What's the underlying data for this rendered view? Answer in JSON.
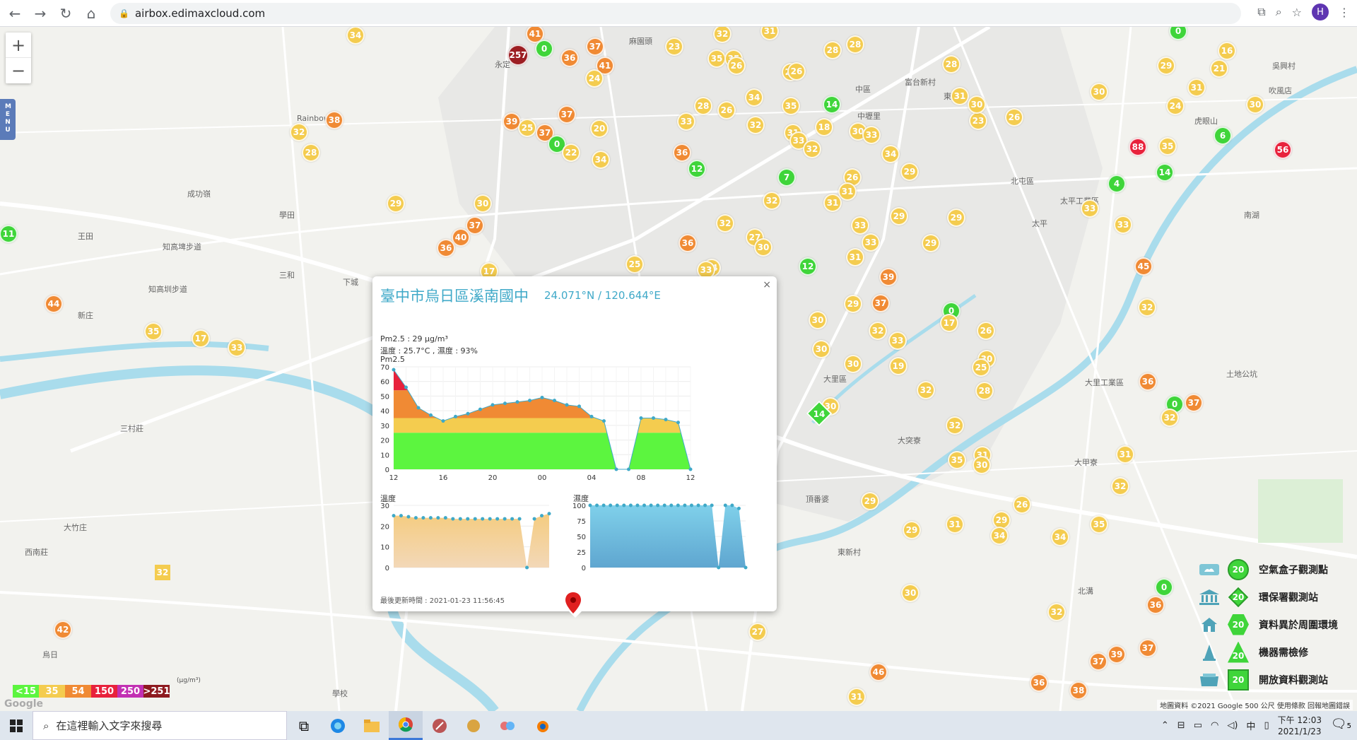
{
  "browser": {
    "url": "airbox.edimaxcloud.com",
    "profile_initial": "H",
    "icons": [
      "back-icon",
      "forward-icon",
      "reload-icon",
      "home-icon",
      "translate-icon",
      "zoom-icon",
      "star-icon",
      "kebab-icon"
    ]
  },
  "map": {
    "zoom_in": "+",
    "zoom_out": "−",
    "menu_label": "MENU",
    "markers": [
      {
        "v": "34",
        "c": "y"
      },
      {
        "v": "41",
        "c": "o"
      },
      {
        "v": "257",
        "c": "d"
      },
      {
        "v": "0",
        "c": "g"
      },
      {
        "v": "36",
        "c": "o"
      },
      {
        "v": "37",
        "c": "o"
      },
      {
        "v": "41",
        "c": "o"
      },
      {
        "v": "24",
        "c": "y"
      },
      {
        "v": "23",
        "c": "y"
      },
      {
        "v": "35",
        "c": "y"
      },
      {
        "v": "32",
        "c": "y"
      },
      {
        "v": "35",
        "c": "y"
      },
      {
        "v": "26",
        "c": "y"
      },
      {
        "v": "31",
        "c": "y"
      },
      {
        "v": "28",
        "c": "y"
      },
      {
        "v": "28",
        "c": "y"
      },
      {
        "v": "26",
        "c": "y"
      },
      {
        "v": "16",
        "c": "y"
      },
      {
        "v": "0",
        "c": "g"
      },
      {
        "v": "29",
        "c": "y"
      },
      {
        "v": "21",
        "c": "y"
      },
      {
        "v": "30",
        "c": "y"
      },
      {
        "v": "31",
        "c": "y"
      },
      {
        "v": "30",
        "c": "y"
      },
      {
        "v": "38",
        "c": "o"
      },
      {
        "v": "32",
        "c": "y"
      },
      {
        "v": "28",
        "c": "y"
      },
      {
        "v": "39",
        "c": "o"
      },
      {
        "v": "25",
        "c": "y"
      },
      {
        "v": "37",
        "c": "o"
      },
      {
        "v": "37",
        "c": "o"
      },
      {
        "v": "0",
        "c": "g"
      },
      {
        "v": "22",
        "c": "y"
      },
      {
        "v": "20",
        "c": "y"
      },
      {
        "v": "34",
        "c": "y"
      },
      {
        "v": "36",
        "c": "o"
      },
      {
        "v": "33",
        "c": "y"
      },
      {
        "v": "28",
        "c": "y"
      },
      {
        "v": "12",
        "c": "g"
      },
      {
        "v": "26",
        "c": "y"
      },
      {
        "v": "32",
        "c": "y"
      },
      {
        "v": "26",
        "c": "y"
      },
      {
        "v": "34",
        "c": "y"
      },
      {
        "v": "35",
        "c": "y"
      },
      {
        "v": "14",
        "c": "g"
      },
      {
        "v": "18",
        "c": "y"
      },
      {
        "v": "31",
        "c": "y"
      },
      {
        "v": "33",
        "c": "y"
      },
      {
        "v": "32",
        "c": "y"
      },
      {
        "v": "30",
        "c": "y"
      },
      {
        "v": "33",
        "c": "y"
      },
      {
        "v": "34",
        "c": "y"
      },
      {
        "v": "23",
        "c": "y"
      },
      {
        "v": "26",
        "c": "y"
      },
      {
        "v": "31",
        "c": "y"
      },
      {
        "v": "30",
        "c": "y"
      },
      {
        "v": "28",
        "c": "y"
      },
      {
        "v": "7",
        "c": "g"
      },
      {
        "v": "26",
        "c": "y"
      },
      {
        "v": "31",
        "c": "y"
      },
      {
        "v": "31",
        "c": "y"
      },
      {
        "v": "29",
        "c": "y"
      },
      {
        "v": "29",
        "c": "y"
      },
      {
        "v": "88",
        "c": "r"
      },
      {
        "v": "35",
        "c": "y"
      },
      {
        "v": "56",
        "c": "r"
      },
      {
        "v": "6",
        "c": "g"
      },
      {
        "v": "24",
        "c": "y"
      },
      {
        "v": "4",
        "c": "g"
      },
      {
        "v": "14",
        "c": "g"
      },
      {
        "v": "33",
        "c": "y"
      },
      {
        "v": "33",
        "c": "y"
      },
      {
        "v": "11",
        "c": "g"
      },
      {
        "v": "29",
        "c": "y"
      },
      {
        "v": "30",
        "c": "y"
      },
      {
        "v": "37",
        "c": "o"
      },
      {
        "v": "40",
        "c": "o"
      },
      {
        "v": "36",
        "c": "o"
      },
      {
        "v": "17",
        "c": "y"
      },
      {
        "v": "25",
        "c": "y"
      },
      {
        "v": "36",
        "c": "o"
      },
      {
        "v": "34",
        "c": "y"
      },
      {
        "v": "33",
        "c": "y"
      },
      {
        "v": "32",
        "c": "y"
      },
      {
        "v": "27",
        "c": "y"
      },
      {
        "v": "30",
        "c": "y"
      },
      {
        "v": "32",
        "c": "y"
      },
      {
        "v": "33",
        "c": "y"
      },
      {
        "v": "31",
        "c": "y"
      },
      {
        "v": "33",
        "c": "y"
      },
      {
        "v": "29",
        "c": "y"
      },
      {
        "v": "29",
        "c": "y"
      },
      {
        "v": "12",
        "c": "g"
      },
      {
        "v": "45",
        "c": "o"
      },
      {
        "v": "32",
        "c": "y"
      },
      {
        "v": "32",
        "c": "y"
      },
      {
        "v": "39",
        "c": "o"
      },
      {
        "v": "37",
        "c": "o"
      },
      {
        "v": "29",
        "c": "y"
      },
      {
        "v": "0",
        "c": "g"
      },
      {
        "v": "17",
        "c": "y"
      },
      {
        "v": "26",
        "c": "y"
      },
      {
        "v": "30",
        "c": "y"
      },
      {
        "v": "30",
        "c": "y"
      },
      {
        "v": "30",
        "c": "y"
      },
      {
        "v": "33",
        "c": "y"
      },
      {
        "v": "30",
        "c": "y"
      },
      {
        "v": "19",
        "c": "y"
      },
      {
        "v": "44",
        "c": "o"
      },
      {
        "v": "35",
        "c": "y"
      },
      {
        "v": "17",
        "c": "y"
      },
      {
        "v": "33",
        "c": "y"
      },
      {
        "v": "32",
        "c": "y"
      },
      {
        "v": "25",
        "c": "y"
      },
      {
        "v": "28",
        "c": "y"
      },
      {
        "v": "36",
        "c": "o"
      },
      {
        "v": "32",
        "c": "y"
      },
      {
        "v": "31",
        "c": "y"
      },
      {
        "v": "37",
        "c": "o"
      },
      {
        "v": "0",
        "c": "g"
      },
      {
        "v": "32",
        "c": "y"
      },
      {
        "v": "31",
        "c": "y"
      },
      {
        "v": "30",
        "c": "y"
      },
      {
        "v": "35",
        "c": "y"
      },
      {
        "v": "30",
        "c": "y"
      },
      {
        "v": "26",
        "c": "y"
      },
      {
        "v": "29",
        "c": "y"
      },
      {
        "v": "31",
        "c": "y"
      },
      {
        "v": "34",
        "c": "y"
      },
      {
        "v": "29",
        "c": "y"
      },
      {
        "v": "34",
        "c": "y"
      },
      {
        "v": "35",
        "c": "y"
      },
      {
        "v": "32",
        "c": "y"
      },
      {
        "v": "30",
        "c": "y"
      },
      {
        "v": "0",
        "c": "g"
      },
      {
        "v": "36",
        "c": "o"
      },
      {
        "v": "39",
        "c": "o"
      },
      {
        "v": "32",
        "c": "y"
      },
      {
        "v": "37",
        "c": "o"
      },
      {
        "v": "37",
        "c": "o"
      },
      {
        "v": "42",
        "c": "o"
      },
      {
        "v": "27",
        "c": "y"
      },
      {
        "v": "46",
        "c": "o"
      },
      {
        "v": "31",
        "c": "y"
      },
      {
        "v": "36",
        "c": "o"
      },
      {
        "v": "38",
        "c": "o"
      },
      {
        "v": "29",
        "c": "y"
      }
    ],
    "square_markers": [
      {
        "v": "32"
      }
    ],
    "diamond_markers": [
      {
        "v": "14"
      }
    ],
    "place_labels": [
      "麻園頭",
      "永定",
      "中壢里",
      "富台新村",
      "東區",
      "吹風店",
      "吳興村",
      "虎眼山",
      "太平",
      "成功嶺",
      "學田",
      "知高埤步道",
      "知高圳步道",
      "三和",
      "下城",
      "王田",
      "新庄",
      "三村莊",
      "大竹庄",
      "西南莊",
      "烏日",
      "溪南",
      "大里區",
      "大里工業區",
      "土地公坑",
      "大甲寮",
      "頂番婆",
      "大突寮",
      "學校",
      "北溝",
      "東新村",
      "太平工業區",
      "南湖",
      "Rainbow",
      "北屯區",
      "中區"
    ],
    "google_label": "Google",
    "attribution": "地圖資料 ©2021 Google   500 公尺   使用條款   回報地圖錯誤"
  },
  "popup": {
    "title": "臺中市烏日區溪南國中",
    "coords": "24.071°N / 120.644°E",
    "pm_line": "Pm2.5 : 29 μg/m³",
    "weather_line": "溫度 : 25.7°C , 濕度 : 93%",
    "pm_chart_label": "Pm2.5",
    "temp_chart_label": "溫度",
    "humidity_chart_label": "濕度",
    "updated": "最後更新時間 : 2021-01-23 11:56:45",
    "close": "×"
  },
  "chart_data": [
    {
      "type": "area",
      "title": "Pm2.5",
      "x": [
        "12",
        "13",
        "14",
        "15",
        "16",
        "17",
        "18",
        "19",
        "20",
        "21",
        "22",
        "23",
        "00",
        "01",
        "02",
        "03",
        "04",
        "05",
        "06",
        "07",
        "08",
        "09",
        "10",
        "11",
        "12"
      ],
      "y": [
        68,
        56,
        42,
        37,
        33,
        36,
        38,
        41,
        44,
        45,
        46,
        47,
        49,
        47,
        44,
        43,
        36,
        33,
        0,
        0,
        35,
        35,
        34,
        32,
        0
      ],
      "xticks": [
        "12",
        "16",
        "20",
        "00",
        "04",
        "08",
        "12"
      ],
      "ylim": [
        0,
        70
      ],
      "yticks": [
        0,
        10,
        20,
        30,
        40,
        50,
        60,
        70
      ],
      "bands": [
        {
          "max": 25,
          "color": "#5cf53f"
        },
        {
          "max": 35,
          "color": "#f4cc4f"
        },
        {
          "max": 54,
          "color": "#f08a34"
        },
        {
          "max": 150,
          "color": "#e8223c"
        }
      ]
    },
    {
      "type": "area",
      "title": "溫度",
      "y": [
        25,
        25,
        24.5,
        24,
        24,
        24,
        24,
        24,
        23.5,
        23.5,
        23.5,
        23.5,
        23.5,
        23.5,
        23.5,
        23.5,
        23.5,
        23.5,
        0,
        23.5,
        25,
        26
      ],
      "ylim": [
        0,
        30
      ],
      "yticks": [
        0,
        10,
        20,
        30
      ]
    },
    {
      "type": "area",
      "title": "濕度",
      "y": [
        100,
        100,
        100,
        100,
        100,
        100,
        100,
        100,
        100,
        100,
        100,
        100,
        100,
        100,
        100,
        100,
        100,
        100,
        100,
        0,
        100,
        100,
        95,
        0
      ],
      "ylim": [
        0,
        100
      ],
      "yticks": [
        0,
        25,
        50,
        75,
        100
      ]
    }
  ],
  "aq_scale": {
    "unit": "(μg/m³)",
    "items": [
      {
        "label": "<15",
        "color": "#5cf53f"
      },
      {
        "label": "35",
        "color": "#f4cc4f"
      },
      {
        "label": "54",
        "color": "#f08a34"
      },
      {
        "label": "150",
        "color": "#e8223c"
      },
      {
        "label": "250",
        "color": "#c230b3"
      },
      {
        "label": ">251",
        "color": "#8e1a1f"
      }
    ]
  },
  "legend": {
    "items": [
      {
        "label": "空氣盒子觀測點",
        "badge": "20",
        "icon": "cloud-box-icon",
        "shape": "circle"
      },
      {
        "label": "環保署觀測站",
        "badge": "20",
        "icon": "government-building-icon",
        "shape": "diamond"
      },
      {
        "label": "資料異於周圍環境",
        "badge": "20",
        "icon": "house-icon",
        "shape": "hexagon"
      },
      {
        "label": "機器需檢修",
        "badge": "20",
        "icon": "cone-icon",
        "shape": "triangle"
      },
      {
        "label": "開放資料觀測站",
        "badge": "20",
        "icon": "open-data-icon",
        "shape": "square"
      }
    ]
  },
  "taskbar": {
    "search_placeholder": "在這裡輸入文字來搜尋",
    "icons": [
      "start-icon",
      "task-view-icon",
      "edge-icon",
      "file-explorer-icon",
      "chrome-icon",
      "app-icon-1",
      "app-icon-2",
      "app-icon-3",
      "blender-icon"
    ],
    "ime": "中",
    "time": "下午 12:03",
    "date": "2021/1/23",
    "notification_count": "5"
  }
}
